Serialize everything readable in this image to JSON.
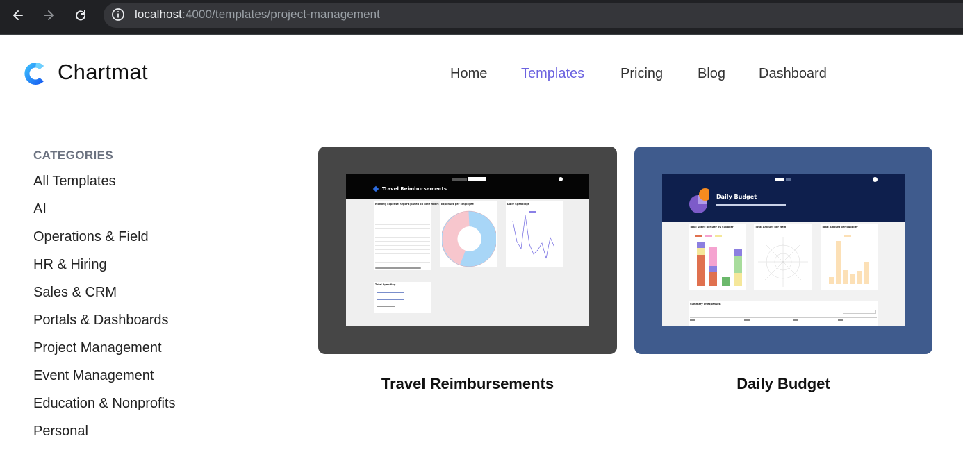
{
  "browser": {
    "url_host": "localhost",
    "url_path": ":4000/templates/project-management"
  },
  "brand": {
    "name": "Chartmat"
  },
  "nav": {
    "items": [
      {
        "label": "Home",
        "active": false
      },
      {
        "label": "Templates",
        "active": true
      },
      {
        "label": "Pricing",
        "active": false
      },
      {
        "label": "Blog",
        "active": false
      },
      {
        "label": "Dashboard",
        "active": false
      }
    ]
  },
  "sidebar": {
    "heading": "CATEGORIES",
    "items": [
      {
        "label": "All Templates"
      },
      {
        "label": "AI"
      },
      {
        "label": "Operations & Field"
      },
      {
        "label": "HR & Hiring"
      },
      {
        "label": "Sales & CRM"
      },
      {
        "label": "Portals & Dashboards"
      },
      {
        "label": "Project Management"
      },
      {
        "label": "Event Management"
      },
      {
        "label": "Education & Nonprofits"
      },
      {
        "label": "Personal"
      }
    ]
  },
  "templates": [
    {
      "title": "Travel Reimbursements",
      "card_color": "#464646",
      "preview": {
        "header_title": "Travel Reimbursements",
        "panel1_title": "Monthly Expense Report (based on date filter)",
        "panel2_title": "Expenses per Employee",
        "panel3_title": "Daily Spendings",
        "panel4_title": "Total Spending"
      }
    },
    {
      "title": "Daily Budget",
      "card_color": "#3f5b8d",
      "preview": {
        "header_title": "Daily Budget",
        "panel1_title": "Total Spent per Day by Supplier",
        "panel2_title": "Total Amount per Item",
        "panel3_title": "Total Amount per Supplier",
        "table_title": "Summary of expenses"
      }
    }
  ],
  "colors": {
    "accent": "#6c63e0",
    "logo_blue": "#1e90ff"
  }
}
